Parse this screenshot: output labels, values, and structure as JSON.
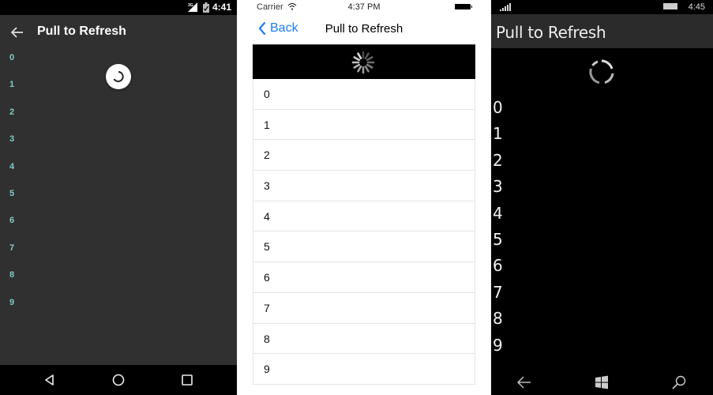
{
  "android": {
    "status_bar": {
      "network": "3G",
      "time": "4:41"
    },
    "toolbar": {
      "back_icon": "arrow-left-icon",
      "title": "Pull to Refresh"
    },
    "refresh_indicator": "circular-spinner",
    "items": [
      "0",
      "1",
      "2",
      "3",
      "4",
      "5",
      "6",
      "7",
      "8",
      "9"
    ],
    "nav_bar": {
      "back": "triangle-back-icon",
      "home": "circle-home-icon",
      "recents": "square-recents-icon"
    },
    "colors": {
      "background": "#303030",
      "item_text": "#80cbc4",
      "status_bar": "#000000"
    }
  },
  "ios": {
    "status_bar": {
      "carrier": "Carrier",
      "time": "4:37 PM"
    },
    "nav": {
      "back_label": "Back",
      "title": "Pull to Refresh"
    },
    "refresh_indicator": "activity-spinner",
    "items": [
      "0",
      "1",
      "2",
      "3",
      "4",
      "5",
      "6",
      "7",
      "8",
      "9"
    ],
    "colors": {
      "tint": "#1a7cf5",
      "refresh_bg": "#000000"
    }
  },
  "windows": {
    "status_bar": {
      "time": "4:45"
    },
    "header": {
      "title": "Pull to Refresh"
    },
    "refresh_indicator": "ring-spinner",
    "items": [
      "0",
      "1",
      "2",
      "3",
      "4",
      "5",
      "6",
      "7",
      "8",
      "9"
    ],
    "nav_bar": {
      "back": "back-arrow-icon",
      "start": "windows-logo-icon",
      "search": "search-icon"
    },
    "colors": {
      "background": "#000000",
      "header_bg": "#2b2b2b"
    }
  }
}
